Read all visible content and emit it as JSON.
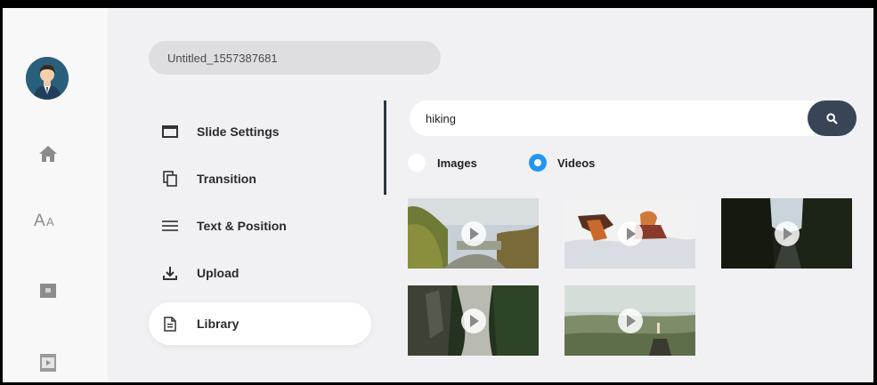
{
  "project": {
    "name": "Untitled_1557387681"
  },
  "rail": {
    "items": [
      {
        "icon": "home-icon"
      },
      {
        "icon": "font-size-icon"
      },
      {
        "icon": "caption-icon"
      },
      {
        "icon": "video-clip-icon"
      }
    ]
  },
  "menu": {
    "items": [
      {
        "label": "Slide Settings",
        "icon": "slide-icon"
      },
      {
        "label": "Transition",
        "icon": "copy-icon"
      },
      {
        "label": "Text & Position",
        "icon": "lines-icon"
      },
      {
        "label": "Upload",
        "icon": "upload-icon"
      },
      {
        "label": "Library",
        "icon": "document-icon",
        "active": true
      }
    ]
  },
  "search": {
    "value": "hiking",
    "placeholder": ""
  },
  "media_type": {
    "options": [
      {
        "label": "Images",
        "selected": false
      },
      {
        "label": "Videos",
        "selected": true
      }
    ]
  },
  "results": [
    {
      "type": "video",
      "scene": "trail-trees"
    },
    {
      "type": "video",
      "scene": "hikers-snow"
    },
    {
      "type": "video",
      "scene": "forest-road"
    },
    {
      "type": "video",
      "scene": "cliff-valley"
    },
    {
      "type": "video",
      "scene": "landscape-hiker"
    }
  ],
  "colors": {
    "accent": "#2196f3",
    "search_button": "#384557",
    "divider": "#2b3646"
  }
}
